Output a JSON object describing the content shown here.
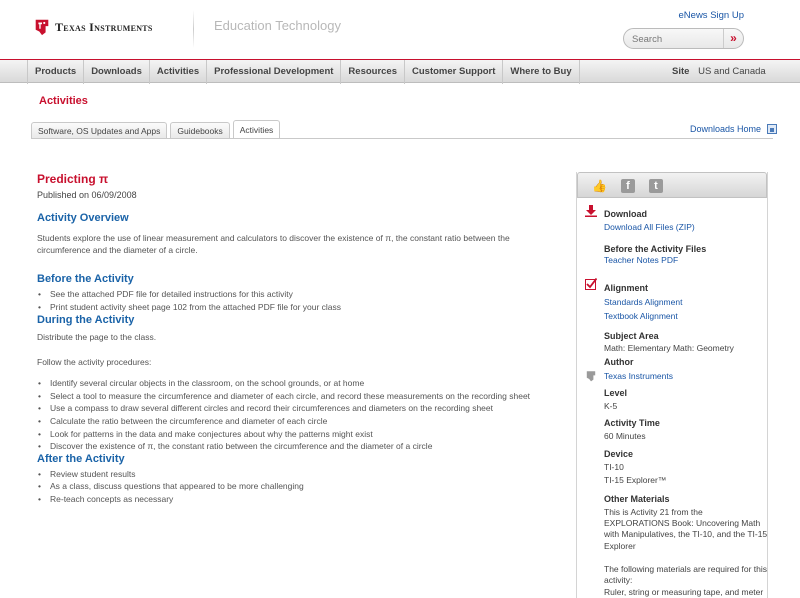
{
  "header": {
    "logo_text": "Texas Instruments",
    "section": "Education Technology",
    "enews": "eNews Sign Up",
    "search_placeholder": "Search",
    "search_button": "»"
  },
  "nav": {
    "items": [
      "Products",
      "Downloads",
      "Activities",
      "Professional Development",
      "Resources",
      "Customer Support",
      "Where to Buy"
    ],
    "site_label": "Site",
    "site_value": "US and Canada"
  },
  "page": {
    "section_title": "Activities",
    "tabs": [
      "Software, OS Updates and Apps",
      "Guidebooks",
      "Activities"
    ],
    "active_tab": "Activities",
    "downloads_home": "Downloads Home"
  },
  "activity": {
    "title": "Predicting π",
    "published": "Published on 06/09/2008",
    "overview_heading": "Activity Overview",
    "overview_text": "Students explore the use of linear measurement and calculators to discover the existence of π, the constant ratio between the circumference and the diameter of a circle.",
    "before_heading": "Before the Activity",
    "before_items": [
      "See the attached PDF file for detailed instructions for this activity",
      "Print student activity sheet page 102 from the attached PDF file for your class"
    ],
    "during_heading": "During the Activity",
    "during_text1": "Distribute the page to the class.",
    "during_text2": "Follow the activity procedures:",
    "during_items": [
      "Identify several circular objects in the classroom, on the school grounds, or at home",
      "Select a tool to measure the circumference and diameter of each circle, and record these measurements on the recording sheet",
      "Use a compass to draw several different circles and record their circumferences and diameters on the recording sheet",
      "Calculate the ratio between the circumference and diameter of each circle",
      "Look for patterns in the data and make conjectures about why the patterns might exist",
      "Discover the existence of π, the constant ratio between the circumference and the diameter of a circle"
    ],
    "after_heading": "After the Activity",
    "after_items": [
      "Review student results",
      "As a class, discuss questions that appeared to be more challenging",
      "Re-teach concepts as necessary"
    ]
  },
  "sidebar": {
    "download_heading": "Download",
    "download_link": "Download All Files (ZIP)",
    "before_files_heading": "Before the Activity Files",
    "teacher_notes": "Teacher Notes PDF",
    "alignment_heading": "Alignment",
    "standards": "Standards Alignment",
    "textbook": "Textbook Alignment",
    "subject_heading": "Subject Area",
    "subject_value": "Math: Elementary Math: Geometry",
    "author_heading": "Author",
    "author_value": "Texas Instruments",
    "level_heading": "Level",
    "level_value": "K-5",
    "time_heading": "Activity Time",
    "time_value": "60 Minutes",
    "device_heading": "Device",
    "devices": [
      "TI-10",
      "TI-15 Explorer™"
    ],
    "materials_heading": "Other Materials",
    "materials_text": "This is Activity 21 from the EXPLORATIONS Book: Uncovering Math with Manipulatives, the TI-10, and the TI-15 Explorer",
    "materials_required": "The following materials are required for this activity:",
    "materials_list": "Ruler, string or measuring tape, and meter"
  }
}
